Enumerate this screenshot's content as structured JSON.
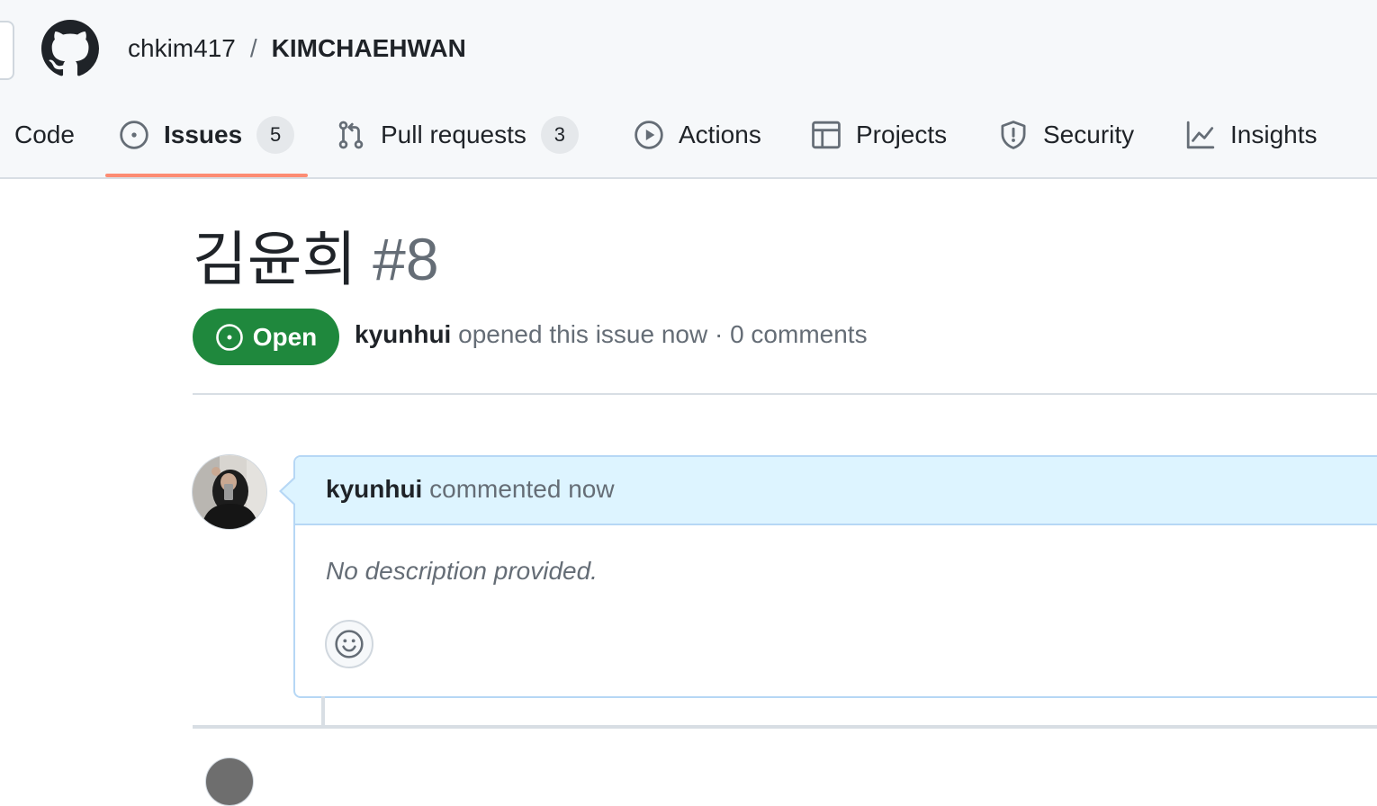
{
  "repo": {
    "owner": "chkim417",
    "separator": "/",
    "name": "KIMCHAEHWAN"
  },
  "tabs": [
    {
      "label": "Code",
      "icon": "code-icon",
      "count": null,
      "selected": false
    },
    {
      "label": "Issues",
      "icon": "issue-opened-icon",
      "count": "5",
      "selected": true
    },
    {
      "label": "Pull requests",
      "icon": "git-pull-request-icon",
      "count": "3",
      "selected": false
    },
    {
      "label": "Actions",
      "icon": "play-icon",
      "count": null,
      "selected": false
    },
    {
      "label": "Projects",
      "icon": "table-icon",
      "count": null,
      "selected": false
    },
    {
      "label": "Security",
      "icon": "shield-icon",
      "count": null,
      "selected": false
    },
    {
      "label": "Insights",
      "icon": "graph-icon",
      "count": null,
      "selected": false
    }
  ],
  "issue": {
    "title": "김윤희",
    "number": "#8",
    "state": "Open",
    "author": "kyunhui",
    "meta_text": " opened this issue now · 0 comments"
  },
  "comment": {
    "author": "kyunhui",
    "action_text": " commented now",
    "body": "No description provided.",
    "reaction_icon": "smiley-icon"
  },
  "colors": {
    "open_green": "#1f883d",
    "tab_underline": "#fd8c73",
    "comment_header_bg": "#ddf4ff",
    "comment_border": "#b6d7f5"
  }
}
